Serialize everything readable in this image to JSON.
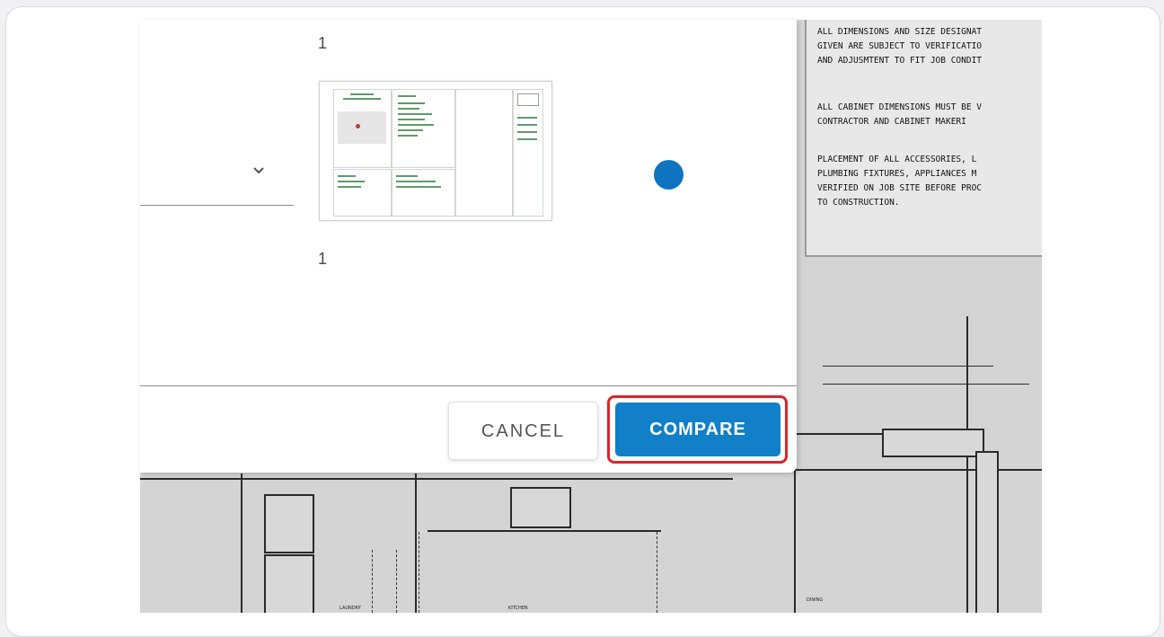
{
  "dialog": {
    "version_number_top": "1",
    "version_number_bottom": "1",
    "cancel_label": "CANCEL",
    "compare_label": "COMPARE",
    "select_icon": "chevron-down-icon",
    "radio_state": "selected"
  },
  "blueprint": {
    "notes": [
      "ALL DIMENSIONS AND SIZE DESIGNAT\nGIVEN ARE SUBJECT TO VERIFICATIO\nAND ADJUSMTENT TO FIT JOB CONDIT",
      "ALL CABINET DIMENSIONS MUST BE V\nCONTRACTOR AND CABINET MAKERI",
      "PLACEMENT OF ALL ACCESSORIES, L\nPLUMBING FIXTURES, APPLIANCES M\nVERIFIED ON JOB SITE BEFORE PROC\nTO CONSTRUCTION."
    ],
    "room_labels": [
      "LAUNDRY",
      "KITCHEN",
      "DINING"
    ]
  },
  "colors": {
    "accent": "#1180c8",
    "highlight": "#d7262c",
    "radio": "#0f74bf"
  }
}
